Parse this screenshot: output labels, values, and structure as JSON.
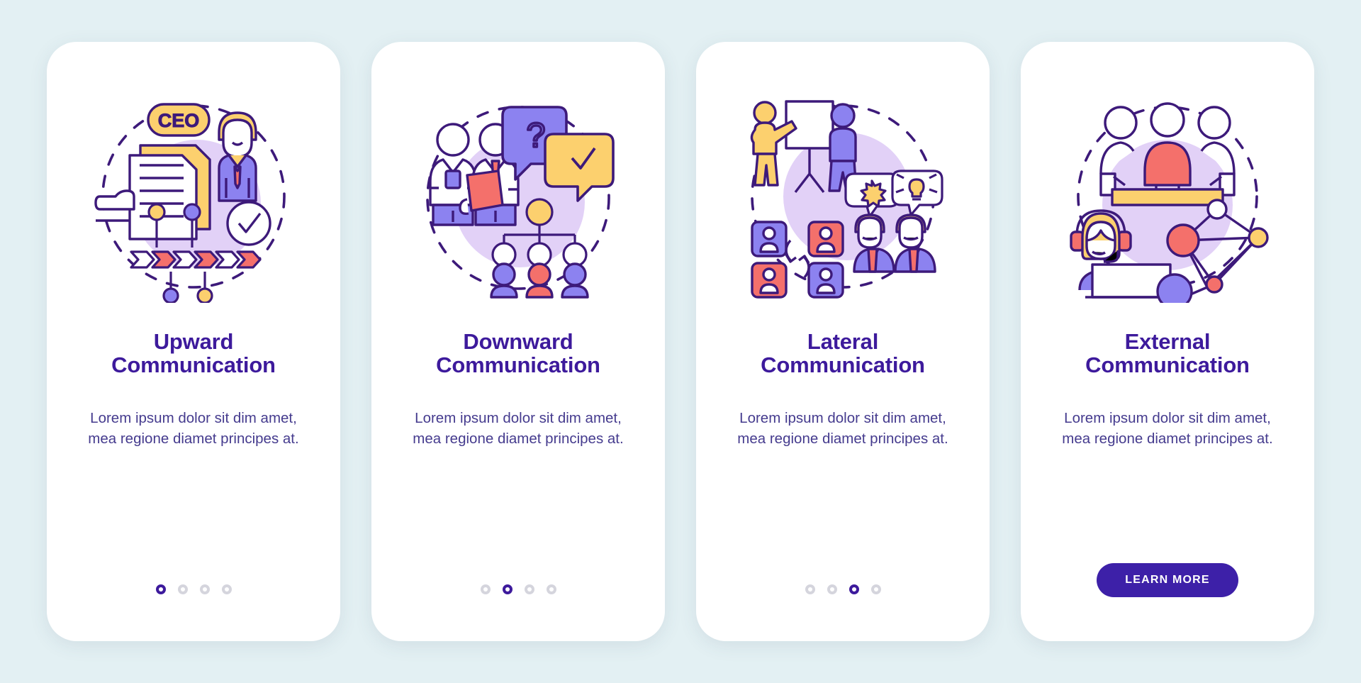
{
  "page": {
    "background_color": "#e3f0f3",
    "card_background": "#ffffff",
    "title_color": "#3d1a9c",
    "body_color": "#453b8e",
    "accent_purple": "#3d20a8",
    "illustration_colors": {
      "outline": "#3d1a7a",
      "lilac_blob": "#e2d1f7",
      "periwinkle": "#8c82f0",
      "yellow": "#fcd06e",
      "coral": "#f4706b",
      "white": "#ffffff"
    }
  },
  "screens": [
    {
      "id": "upward-communication",
      "title_line1": "Upward",
      "title_line2": "Communication",
      "description": "Lorem ipsum dolor sit dim amet, mea regione diamet principes at.",
      "illustration_name": "ceo-document-approval-illustration",
      "illustration_elements": [
        "CEO"
      ],
      "dots": {
        "count": 4,
        "active_index": 0
      },
      "has_learn_more": false,
      "learn_more_label": ""
    },
    {
      "id": "downward-communication",
      "title_line1": "Downward",
      "title_line2": "Communication",
      "description": "Lorem ipsum dolor sit dim amet, mea regione diamet principes at.",
      "illustration_name": "managers-org-chart-speech-bubbles-illustration",
      "illustration_elements": [
        "?",
        "✓"
      ],
      "dots": {
        "count": 4,
        "active_index": 1
      },
      "has_learn_more": false,
      "learn_more_label": ""
    },
    {
      "id": "lateral-communication",
      "title_line1": "Lateral",
      "title_line2": "Communication",
      "description": "Lorem ipsum dolor sit dim amet, mea regione diamet principes at.",
      "illustration_name": "presentation-peer-exchange-illustration",
      "illustration_elements": [],
      "dots": {
        "count": 4,
        "active_index": 2
      },
      "has_learn_more": false,
      "learn_more_label": ""
    },
    {
      "id": "external-communication",
      "title_line1": "External",
      "title_line2": "Communication",
      "description": "Lorem ipsum dolor sit dim amet, mea regione diamet principes at.",
      "illustration_name": "support-agent-network-meeting-illustration",
      "illustration_elements": [],
      "dots": {
        "count": 4,
        "active_index": 3
      },
      "has_learn_more": true,
      "learn_more_label": "LEARN MORE"
    }
  ]
}
